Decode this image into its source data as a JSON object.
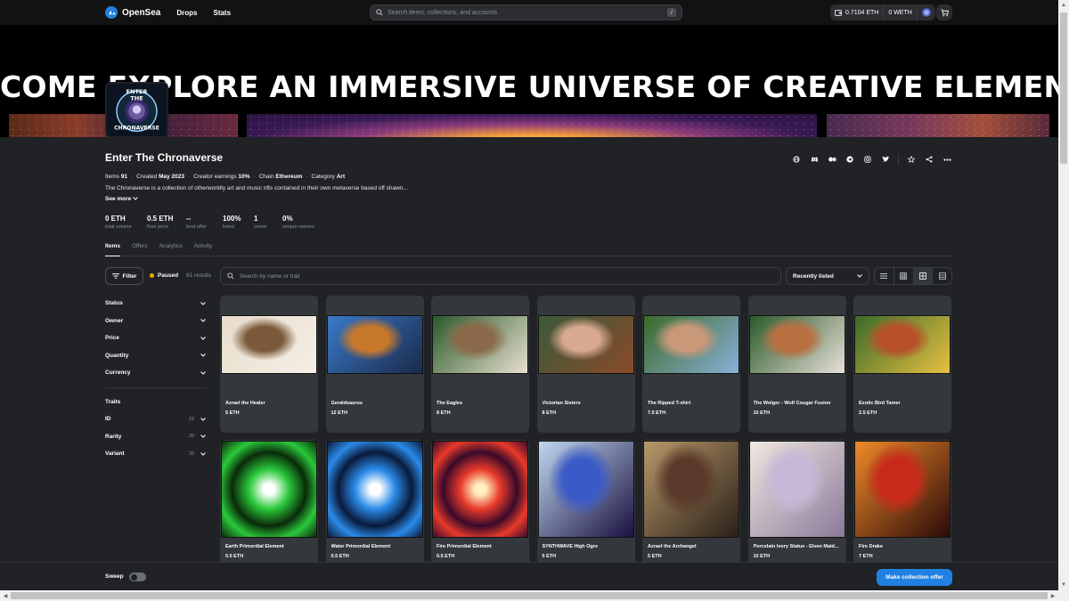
{
  "nav": {
    "brand": "OpenSea",
    "links": [
      "Drops",
      "Stats"
    ],
    "search_placeholder": "Search items, collections, and accounts",
    "search_shortcut": "/",
    "eth_balance": "0.7104 ETH",
    "weth_balance": "0 WETH"
  },
  "banner": {
    "headline": "COME EXPLORE AN IMMERSIVE UNIVERSE OF CREATIVE ELEMENTS",
    "avatar_text": [
      "ENTER",
      "THE",
      "CHRONAVERSE"
    ]
  },
  "collection": {
    "title": "Enter The Chronaverse",
    "meta": [
      {
        "label": "Items",
        "value": "91"
      },
      {
        "label": "Created",
        "value": "May 2023"
      },
      {
        "label": "Creator earnings",
        "value": "10%"
      },
      {
        "label": "Chain",
        "value": "Ethereum"
      },
      {
        "label": "Category",
        "value": "Art"
      }
    ],
    "description": "The Chronaverse is a collection of otherworldly art and music nfts contained in their own metaverse based off shawn...",
    "see_more": "See more",
    "stats": [
      {
        "value": "0 ETH",
        "label": "total volume"
      },
      {
        "value": "0.5 ETH",
        "label": "floor price"
      },
      {
        "value": "--",
        "label": "best offer"
      },
      {
        "value": "100%",
        "label": "listed"
      },
      {
        "value": "1",
        "label": "owner"
      },
      {
        "value": "0%",
        "label": "unique owners"
      }
    ]
  },
  "tabs": [
    "Items",
    "Offers",
    "Analytics",
    "Activity"
  ],
  "toolbar": {
    "filter_label": "Filter",
    "status": "Paused",
    "results": "91 results",
    "search_placeholder": "Search by name or trait",
    "sort": "Recently listed"
  },
  "filters": {
    "main": [
      "Status",
      "Owner",
      "Price",
      "Quantity",
      "Currency"
    ],
    "traits_heading": "Traits",
    "traits": [
      {
        "name": "ID",
        "count": "19"
      },
      {
        "name": "Rarity",
        "count": "20"
      },
      {
        "name": "Variant",
        "count": "20"
      }
    ]
  },
  "items": [
    {
      "name": "Azrael the Healer",
      "price": "5 ETH",
      "palette": [
        "#e8dccb",
        "#7a5a3a",
        "#f5efe6"
      ]
    },
    {
      "name": "Geraldsaurus",
      "price": "12 ETH",
      "palette": [
        "#3a7ac8",
        "#c8782a",
        "#1a2a4a"
      ]
    },
    {
      "name": "The Eagles",
      "price": "8 ETH",
      "palette": [
        "#2a5a2a",
        "#8a6a4a",
        "#e8e0d0"
      ]
    },
    {
      "name": "Victorian Sisters",
      "price": "8 ETH",
      "palette": [
        "#3a5a3a",
        "#d8a890",
        "#8a4a2a"
      ]
    },
    {
      "name": "The Ripped T-shirt",
      "price": "7.5 ETH",
      "palette": [
        "#3a6a2a",
        "#c89878",
        "#8ab0d8"
      ]
    },
    {
      "name": "The Wolger - Wolf Cougar Fusion",
      "price": "10 ETH",
      "palette": [
        "#2a5a2a",
        "#b87040",
        "#e8e0d8"
      ]
    },
    {
      "name": "Exotic Bird Tamer",
      "price": "2.5 ETH",
      "palette": [
        "#3a6a2a",
        "#b8502a",
        "#e8c040"
      ]
    },
    {
      "name": "Earth Primordial Element",
      "price": "0.5 ETH",
      "palette": [
        "#ffffff",
        "#2ac83a",
        "#0a2a0a"
      ]
    },
    {
      "name": "Water Primordial Element",
      "price": "0.5 ETH",
      "palette": [
        "#ffffff",
        "#2a8ae8",
        "#0a1a3a"
      ]
    },
    {
      "name": "Fire Primordial Element",
      "price": "0.5 ETH",
      "palette": [
        "#fff0c0",
        "#e83a2a",
        "#3a0a2a"
      ]
    },
    {
      "name": "SYNTHWAVE High Ogre",
      "price": "5 ETH",
      "palette": [
        "#c0d8f0",
        "#3a5ac8",
        "#1a1040"
      ]
    },
    {
      "name": "Azrael the Archangel",
      "price": "5 ETH",
      "palette": [
        "#b8986a",
        "#5a3a2a",
        "#2a2018"
      ]
    },
    {
      "name": "Porcelain Ivory Statue - Elven Maid...",
      "price": "10 ETH",
      "palette": [
        "#f0e8e0",
        "#c8b8d8",
        "#8a7a9a"
      ]
    },
    {
      "name": "Fire Drake",
      "price": "7 ETH",
      "palette": [
        "#f08a2a",
        "#c82a1a",
        "#2a0a0a"
      ]
    }
  ],
  "footer": {
    "sweep": "Sweep",
    "offer_button": "Make collection offer"
  },
  "colors": {
    "accent": "#2081e2",
    "background": "#202225",
    "card": "#34373c",
    "paused_dot": "#e8b100"
  },
  "icons": [
    "globe-icon",
    "discord-icon",
    "medium-icon",
    "telegram-icon",
    "instagram-icon",
    "twitter-icon",
    "star-icon",
    "share-icon",
    "more-icon"
  ]
}
